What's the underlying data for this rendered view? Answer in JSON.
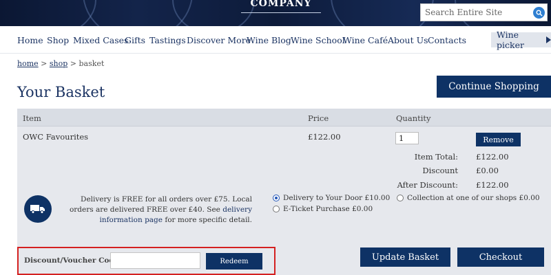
{
  "header": {
    "brand": "COMPANY",
    "search_placeholder": "Search Entire Site"
  },
  "nav": {
    "items": [
      "Home",
      "Shop",
      "Mixed Cases",
      "Gifts",
      "Tastings",
      "Discover More",
      "Wine Blog",
      "Wine School",
      "Wine Café",
      "About Us",
      "Contacts"
    ],
    "wine_picker": "Wine picker"
  },
  "breadcrumb": {
    "home": "home",
    "sep1": ">",
    "shop": "shop",
    "sep2": ">",
    "current": "basket"
  },
  "page": {
    "title": "Your Basket",
    "continue_label": "Continue Shopping"
  },
  "table": {
    "headers": {
      "item": "Item",
      "price": "Price",
      "quantity": "Quantity"
    },
    "row": {
      "name": "OWC Favourites",
      "price": "£122.00",
      "quantity": "1",
      "remove_label": "Remove"
    },
    "totals": {
      "item_total_label": "Item Total:",
      "item_total": "£122.00",
      "discount_label": "Discount",
      "discount": "£0.00",
      "after_discount_label": "After Discount:",
      "after_discount": "£122.00"
    }
  },
  "delivery": {
    "text_before_link": "Delivery is FREE for all orders over £75. Local orders are delivered FREE over £40. See",
    "link": "delivery information page",
    "text_after_link": "for more specific detail.",
    "options": [
      {
        "label": "Delivery to Your Door £10.00",
        "checked": true
      },
      {
        "label": "E-Ticket Purchase £0.00",
        "checked": false
      },
      {
        "label": "Collection at one of our shops £0.00",
        "checked": false
      }
    ]
  },
  "voucher": {
    "label": "Discount/Voucher Code",
    "value": "",
    "redeem_label": "Redeem"
  },
  "actions": {
    "update_label": "Update Basket",
    "checkout_label": "Checkout"
  },
  "colors": {
    "navy": "#0e3265",
    "highlight_border": "#d42020"
  }
}
